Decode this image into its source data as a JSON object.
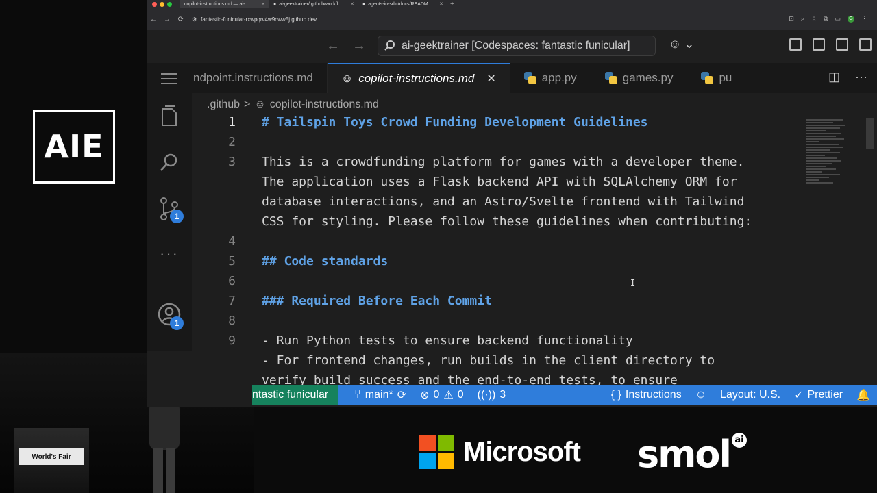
{
  "overlay": {
    "aie_logo": "AIE",
    "podium_sign": "World's Fair",
    "brand_microsoft": "Microsoft",
    "brand_smol": "smol",
    "brand_smol_badge": "ai"
  },
  "browser": {
    "tabs": [
      {
        "label": "copilot-instructions.md — ai-",
        "active": true
      },
      {
        "label": "ai-geektrainer/.github/workfl",
        "active": false
      },
      {
        "label": "agents-in-sdlc/docs/READM",
        "active": false
      }
    ],
    "new_tab": "+",
    "url": "fantastic-funicular-rxwpqrv4w9cww5j.github.dev",
    "profile_initial": "G"
  },
  "vscode": {
    "command_center": "ai-geektrainer [Codespaces: fantastic funicular]",
    "tabs": [
      {
        "label": "ndpoint.instructions.md",
        "icon": "none",
        "active": false
      },
      {
        "label": "copilot-instructions.md",
        "icon": "copilot-icon",
        "active": true,
        "close": "✕"
      },
      {
        "label": "app.py",
        "icon": "python-icon",
        "active": false
      },
      {
        "label": "games.py",
        "icon": "python-icon",
        "active": false
      },
      {
        "label": "pu",
        "icon": "python-icon",
        "active": false
      }
    ],
    "breadcrumbs": {
      "folder": ".github",
      "separator": ">",
      "file": "copilot-instructions.md"
    },
    "badges": {
      "source_control": "1",
      "accounts": "1"
    },
    "editor_lines": [
      {
        "n": "1",
        "text": "# Tailspin Toys Crowd Funding Development Guidelines",
        "style": "heading"
      },
      {
        "n": "2",
        "text": "",
        "style": "plain"
      },
      {
        "n": "3",
        "text": "This is a crowdfunding platform for games with a developer theme.",
        "style": "plain"
      },
      {
        "n": "",
        "text": "The application uses a Flask backend API with SQLAlchemy ORM for",
        "style": "plain"
      },
      {
        "n": "",
        "text": "database interactions, and an Astro/Svelte frontend with Tailwind",
        "style": "plain"
      },
      {
        "n": "",
        "text": "CSS for styling. Please follow these guidelines when contributing:",
        "style": "plain"
      },
      {
        "n": "4",
        "text": "",
        "style": "plain"
      },
      {
        "n": "5",
        "text": "## Code standards",
        "style": "heading"
      },
      {
        "n": "6",
        "text": "",
        "style": "plain"
      },
      {
        "n": "7",
        "text": "### Required Before Each Commit",
        "style": "heading"
      },
      {
        "n": "8",
        "text": "",
        "style": "plain"
      },
      {
        "n": "9",
        "text": "- Run Python tests to ensure backend functionality",
        "style": "list"
      },
      {
        "n": "",
        "text": "- For frontend changes, run builds in the client directory to",
        "style": "list"
      },
      {
        "n": "",
        "text": "verify build success and the end-to-end tests, to ensure",
        "style": "plain"
      }
    ],
    "status_bar": {
      "remote": "ntastic funicular",
      "branch": "main*",
      "errors": "0",
      "warnings": "0",
      "ports": "3",
      "language": "Instructions",
      "layout": "Layout: U.S.",
      "formatter": "Prettier"
    }
  },
  "colors": {
    "accent": "#2f7ddb",
    "remote": "#16825d",
    "heading": "#5fa2e6",
    "ms_red": "#f25022",
    "ms_green": "#7fba00",
    "ms_blue": "#00a4ef",
    "ms_yellow": "#ffb900"
  }
}
